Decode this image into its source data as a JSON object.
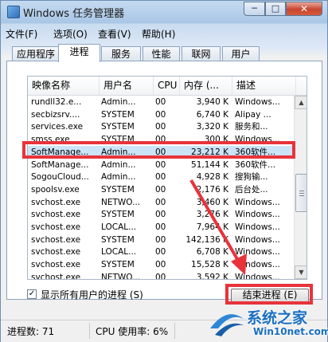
{
  "window": {
    "title": "Windows 任务管理器",
    "buttons": {
      "minimize": "─",
      "maximize": "□",
      "close": "✕"
    }
  },
  "menu": [
    "文件(F)",
    "选项(O)",
    "查看(V)",
    "帮助(H)"
  ],
  "tabs": [
    "应用程序",
    "进程",
    "服务",
    "性能",
    "联网",
    "用户"
  ],
  "active_tab": "进程",
  "columns": [
    "映像名称",
    "用户名",
    "CPU",
    "内存 (...",
    "描述"
  ],
  "processes": [
    {
      "name": "rundll32.e...",
      "user": "Admin...",
      "cpu": "00",
      "mem": "3,940 K",
      "desc": "Windows..."
    },
    {
      "name": "secbizsrv....",
      "user": "SYSTEM",
      "cpu": "00",
      "mem": "6,740 K",
      "desc": "Alipay ..."
    },
    {
      "name": "services.exe",
      "user": "SYSTEM",
      "cpu": "00",
      "mem": "3,320 K",
      "desc": "服务和..."
    },
    {
      "name": "smss.exe",
      "user": "SYSTEM",
      "cpu": "00",
      "mem": "300 K",
      "desc": "Windows..."
    },
    {
      "name": "SoftManage...",
      "user": "Admin...",
      "cpu": "00",
      "mem": "23,212 K",
      "desc": "360软件..."
    },
    {
      "name": "SoftManage...",
      "user": "Admin...",
      "cpu": "00",
      "mem": "51,144 K",
      "desc": "360软件..."
    },
    {
      "name": "SogouCloud...",
      "user": "Admin...",
      "cpu": "00",
      "mem": "4,928 K",
      "desc": "搜狗输..."
    },
    {
      "name": "spoolsv.exe",
      "user": "SYSTEM",
      "cpu": "00",
      "mem": "2,176 K",
      "desc": "后台处..."
    },
    {
      "name": "svchost.exe",
      "user": "NETWO...",
      "cpu": "00",
      "mem": "3,460 K",
      "desc": "Windows..."
    },
    {
      "name": "svchost.exe",
      "user": "SYSTEM",
      "cpu": "00",
      "mem": "3,276 K",
      "desc": "Windows..."
    },
    {
      "name": "svchost.exe",
      "user": "LOCAL...",
      "cpu": "00",
      "mem": "7,964 K",
      "desc": "Windows..."
    },
    {
      "name": "svchost.exe",
      "user": "SYSTEM",
      "cpu": "00",
      "mem": "142,136 K",
      "desc": "Windows..."
    },
    {
      "name": "svchost.exe",
      "user": "LOCAL...",
      "cpu": "00",
      "mem": "6,708 K",
      "desc": "Windows..."
    },
    {
      "name": "svchost.exe",
      "user": "SYSTEM",
      "cpu": "00",
      "mem": "15,528 K",
      "desc": "Windows..."
    },
    {
      "name": "svchost.exe",
      "user": "NETWO...",
      "cpu": "00",
      "mem": "3,592 K",
      "desc": "Windows..."
    }
  ],
  "selected_row": 4,
  "show_all_users": {
    "label": "显示所有用户的进程 (S)",
    "checked": true,
    "mark": "✓"
  },
  "end_process_button": "结束进程 (E)",
  "status": {
    "processes": "进程数: 71",
    "cpu": "CPU 使用率: 6%"
  },
  "watermark": {
    "brand": "系统之家",
    "site": "Win10net.com"
  },
  "colors": {
    "annotation": "#e8333a",
    "selection": "#cce4f7"
  }
}
